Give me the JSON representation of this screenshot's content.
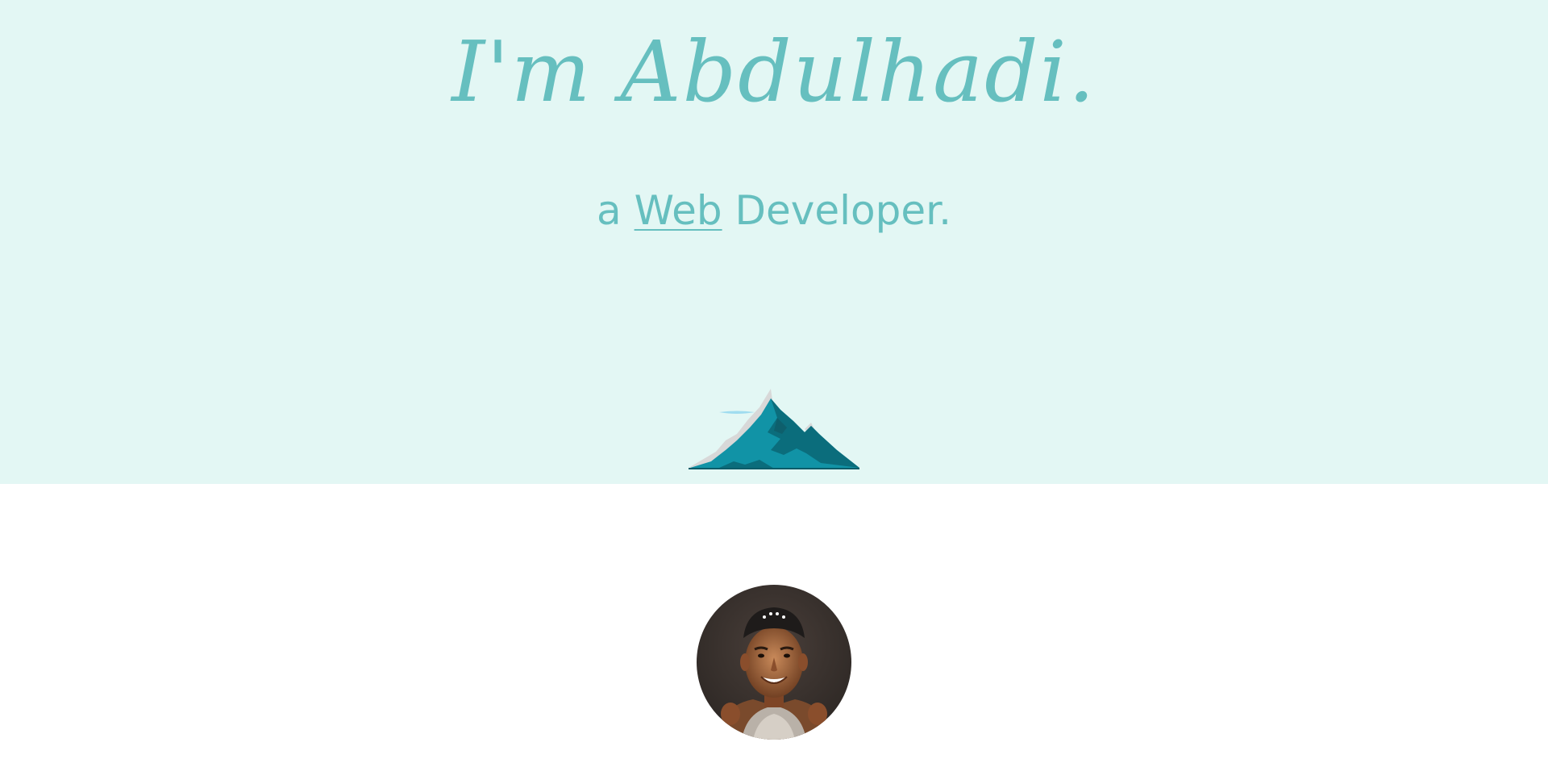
{
  "hero": {
    "title": "I'm Abdulhadi.",
    "subtitle_prefix": "a",
    "subtitle_highlight": "Web",
    "subtitle_suffix": "Developer.",
    "mountain_icon": "mountain-illustration",
    "colors": {
      "background": "#e3f7f4",
      "text": "#66bfbf"
    }
  },
  "about": {
    "avatar_icon": "profile-photo",
    "background": "#ffffff"
  }
}
